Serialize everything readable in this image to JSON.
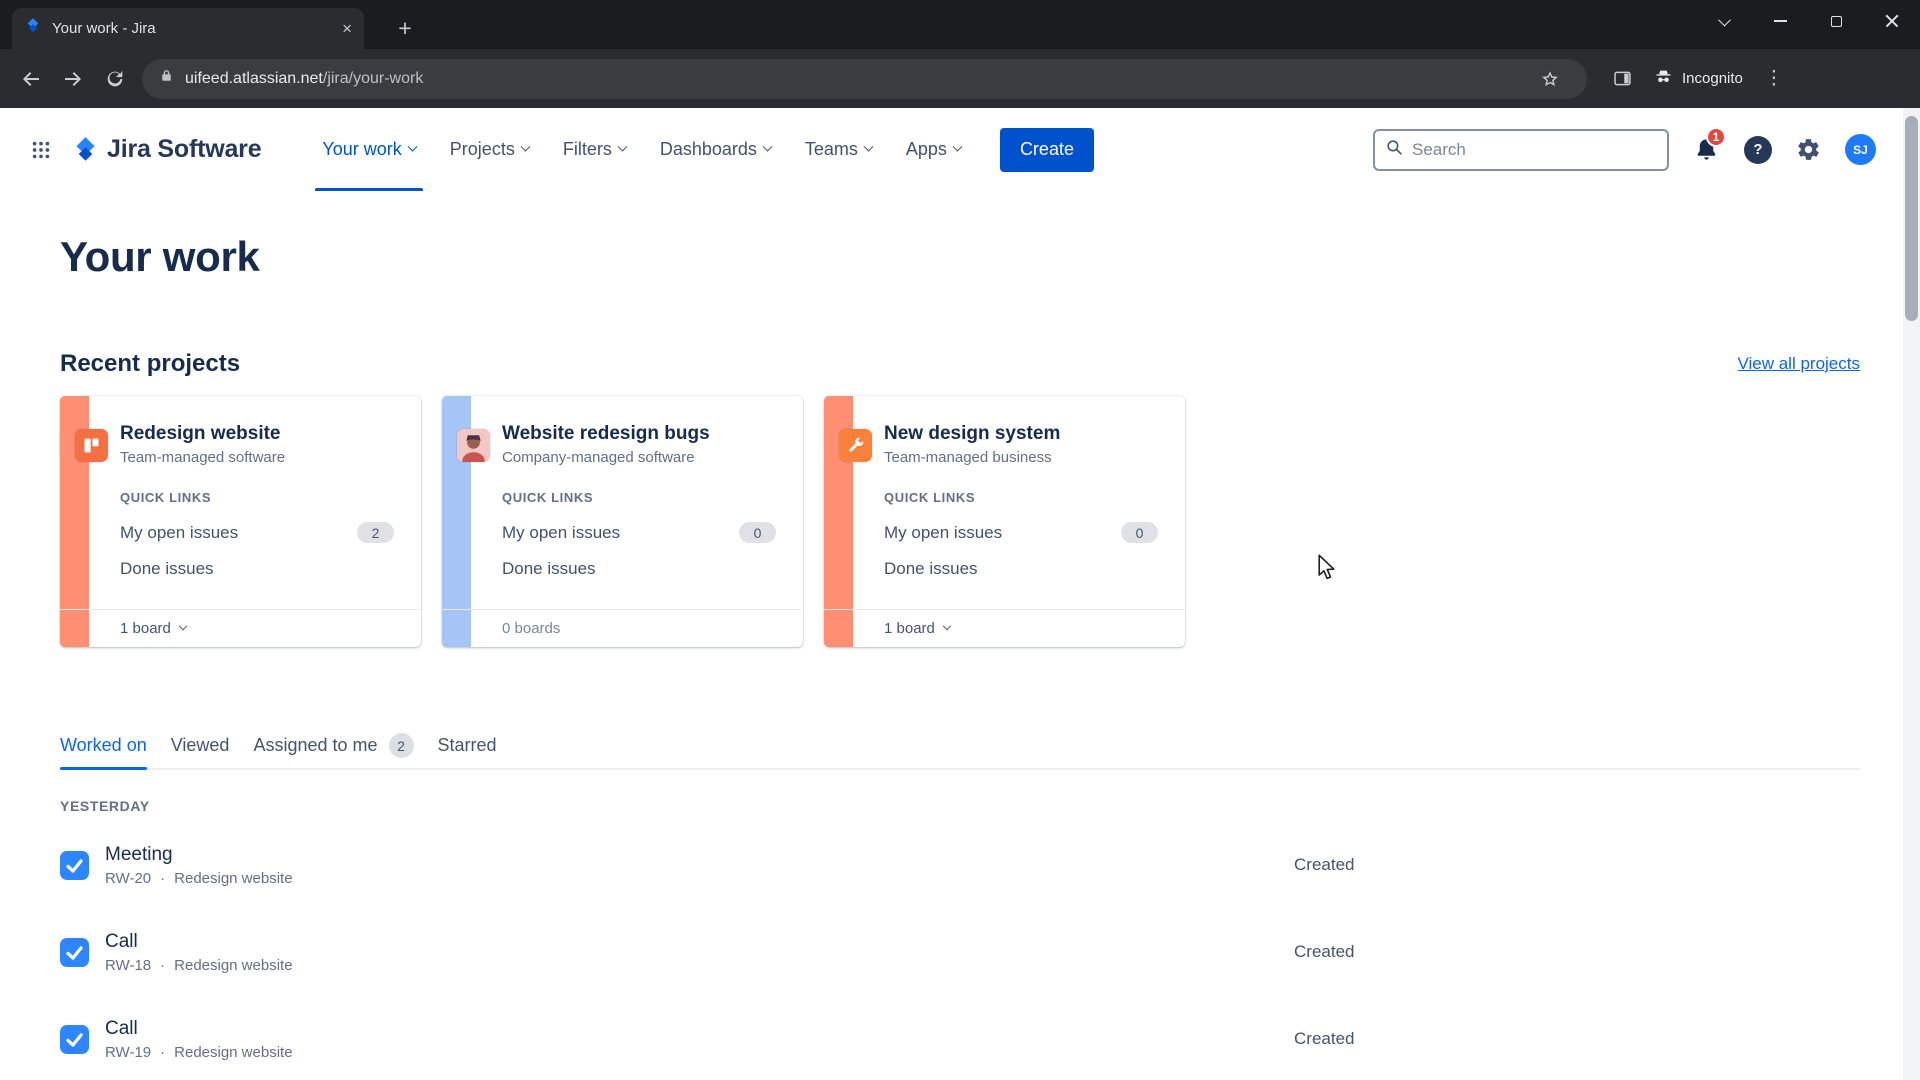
{
  "browser": {
    "tab_title": "Your work - Jira",
    "url_host": "uifeed.atlassian.net",
    "url_path": "/jira/your-work",
    "incognito_label": "Incognito",
    "new_tab_glyph": "+",
    "tab_close_glyph": "×",
    "kebab_glyph": "⋮"
  },
  "header": {
    "logo_text": "Jira Software",
    "nav": [
      {
        "label": "Your work"
      },
      {
        "label": "Projects"
      },
      {
        "label": "Filters"
      },
      {
        "label": "Dashboards"
      },
      {
        "label": "Teams"
      },
      {
        "label": "Apps"
      }
    ],
    "create_label": "Create",
    "search_placeholder": "Search",
    "notification_count": "1",
    "help_glyph": "?",
    "avatar_initials": "SJ"
  },
  "page": {
    "title": "Your work",
    "recent_projects": {
      "heading": "Recent projects",
      "view_all_label": "View all projects"
    },
    "quick_links_label": "QUICK LINKS",
    "cards": [
      {
        "title": "Redesign website",
        "subtitle": "Team-managed software",
        "open_issues_label": "My open issues",
        "open_issues_count": "2",
        "done_issues_label": "Done issues",
        "footer_label": "1 board",
        "accent_color": "#FF8F73"
      },
      {
        "title": "Website redesign bugs",
        "subtitle": "Company-managed software",
        "open_issues_label": "My open issues",
        "open_issues_count": "0",
        "done_issues_label": "Done issues",
        "footer_label": "0 boards",
        "accent_color": "#A6C5F7"
      },
      {
        "title": "New design system",
        "subtitle": "Team-managed business",
        "open_issues_label": "My open issues",
        "open_issues_count": "0",
        "done_issues_label": "Done issues",
        "footer_label": "1 board",
        "accent_color": "#FF8F73"
      }
    ],
    "tabs": [
      {
        "label": "Worked on"
      },
      {
        "label": "Viewed"
      },
      {
        "label": "Assigned to me",
        "badge": "2"
      },
      {
        "label": "Starred"
      }
    ],
    "section_label": "YESTERDAY",
    "item_separator": "·",
    "items": [
      {
        "title": "Meeting",
        "key": "RW-20",
        "project": "Redesign website",
        "status": "Created"
      },
      {
        "title": "Call",
        "key": "RW-18",
        "project": "Redesign website",
        "status": "Created"
      },
      {
        "title": "Call",
        "key": "RW-19",
        "project": "Redesign website",
        "status": "Created"
      }
    ]
  },
  "colors": {
    "brand_blue": "#0052CC",
    "active_link": "#0C66E4",
    "notification_red": "#E2483D",
    "task_icon_blue": "#2E86FF",
    "card_accent_salmon": "#FF8F73",
    "card_accent_blue": "#A6C5F7"
  }
}
